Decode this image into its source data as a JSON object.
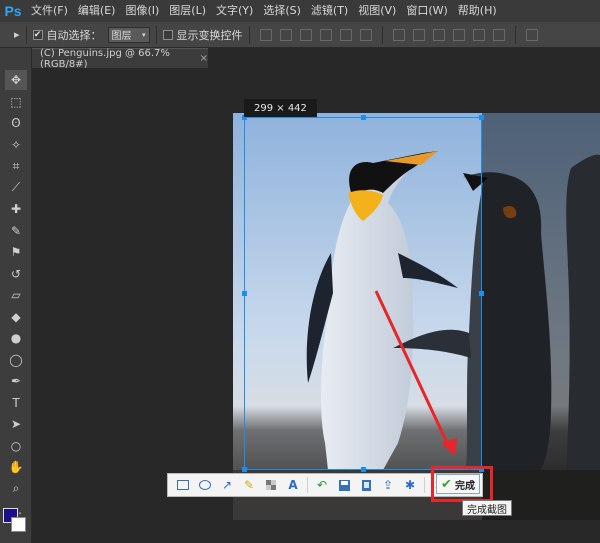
{
  "app": {
    "logo": "Ps"
  },
  "menu": [
    "文件(F)",
    "编辑(E)",
    "图像(I)",
    "图层(L)",
    "文字(Y)",
    "选择(S)",
    "滤镜(T)",
    "视图(V)",
    "窗口(W)",
    "帮助(H)"
  ],
  "options": {
    "auto_select_label": "自动选择：",
    "auto_select_checked": "✔",
    "layer_select_value": "图层",
    "show_transform_label": "显示变换控件"
  },
  "document_tab": {
    "title": "(C) Penguins.jpg @ 66.7%(RGB/8#)",
    "close": "×"
  },
  "tools": [
    {
      "name": "move-tool",
      "glyph": "✥"
    },
    {
      "name": "marquee-tool",
      "glyph": "⬚"
    },
    {
      "name": "lasso-tool",
      "glyph": "ʘ"
    },
    {
      "name": "quick-select-tool",
      "glyph": "✧"
    },
    {
      "name": "crop-tool",
      "glyph": "⌗"
    },
    {
      "name": "eyedropper-tool",
      "glyph": "⟋"
    },
    {
      "name": "healing-tool",
      "glyph": "✚"
    },
    {
      "name": "brush-tool",
      "glyph": "✎"
    },
    {
      "name": "stamp-tool",
      "glyph": "⚑"
    },
    {
      "name": "history-brush-tool",
      "glyph": "↺"
    },
    {
      "name": "eraser-tool",
      "glyph": "▱"
    },
    {
      "name": "paint-bucket-tool",
      "glyph": "◆"
    },
    {
      "name": "blur-tool",
      "glyph": "●"
    },
    {
      "name": "dodge-tool",
      "glyph": "◯"
    },
    {
      "name": "pen-tool",
      "glyph": "✒"
    },
    {
      "name": "type-tool",
      "glyph": "T"
    },
    {
      "name": "path-select-tool",
      "glyph": "➤"
    },
    {
      "name": "shape-tool",
      "glyph": "○"
    },
    {
      "name": "hand-tool",
      "glyph": "✋"
    },
    {
      "name": "zoom-tool",
      "glyph": "⌕"
    },
    {
      "name": "extra-tools",
      "glyph": "…"
    }
  ],
  "colors": {
    "foreground": "#1b0f8a",
    "background": "#ffffff",
    "selection": "#1e8fe8",
    "highlight": "#e8262a"
  },
  "selection": {
    "size_label": "299 × 442"
  },
  "screenshot_toolbar": {
    "icons": [
      "rectangle-icon",
      "ellipse-icon",
      "arrow-icon",
      "pen-icon",
      "mosaic-icon",
      "text-icon",
      "undo-icon",
      "save-icon",
      "copy-icon",
      "share-icon",
      "pin-icon",
      "cancel-icon"
    ],
    "done_label": "完成",
    "tooltip": "完成截图"
  }
}
